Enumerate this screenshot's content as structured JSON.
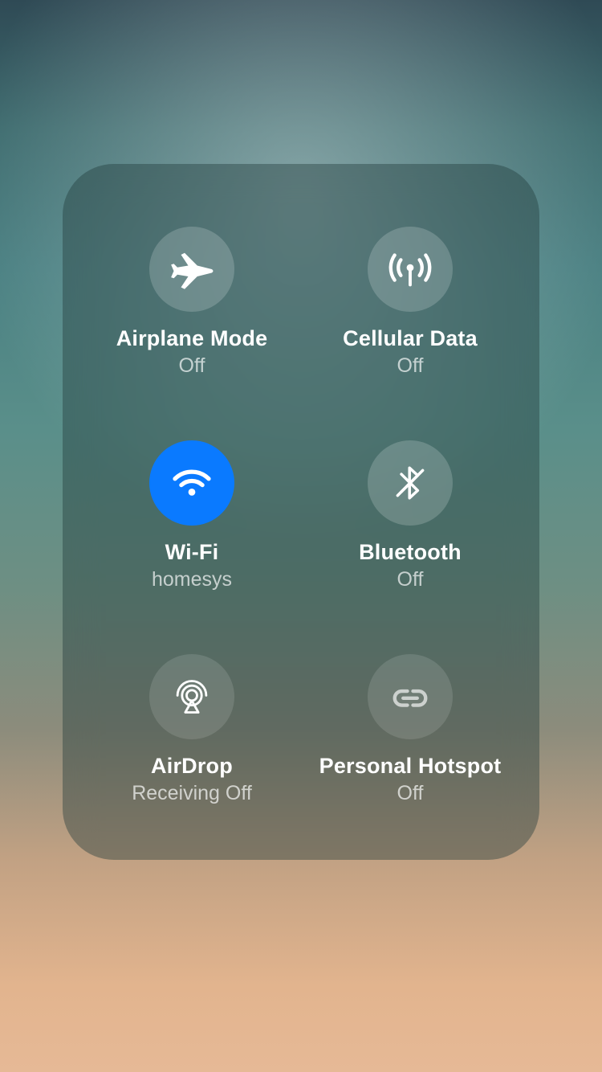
{
  "controls": {
    "airplane": {
      "label": "Airplane Mode",
      "status": "Off",
      "active": false,
      "dimmed": false
    },
    "cellular": {
      "label": "Cellular Data",
      "status": "Off",
      "active": false,
      "dimmed": false
    },
    "wifi": {
      "label": "Wi-Fi",
      "status": "homesys",
      "active": true,
      "dimmed": false
    },
    "bluetooth": {
      "label": "Bluetooth",
      "status": "Off",
      "active": false,
      "dimmed": false
    },
    "airdrop": {
      "label": "AirDrop",
      "status": "Receiving Off",
      "active": false,
      "dimmed": true
    },
    "hotspot": {
      "label": "Personal Hotspot",
      "status": "Off",
      "active": false,
      "dimmed": true
    }
  },
  "colors": {
    "active_blue": "#0a7aff",
    "inactive_fill": "rgba(255,255,255,0.18)",
    "dimmed_fill": "rgba(255,255,255,0.12)"
  }
}
